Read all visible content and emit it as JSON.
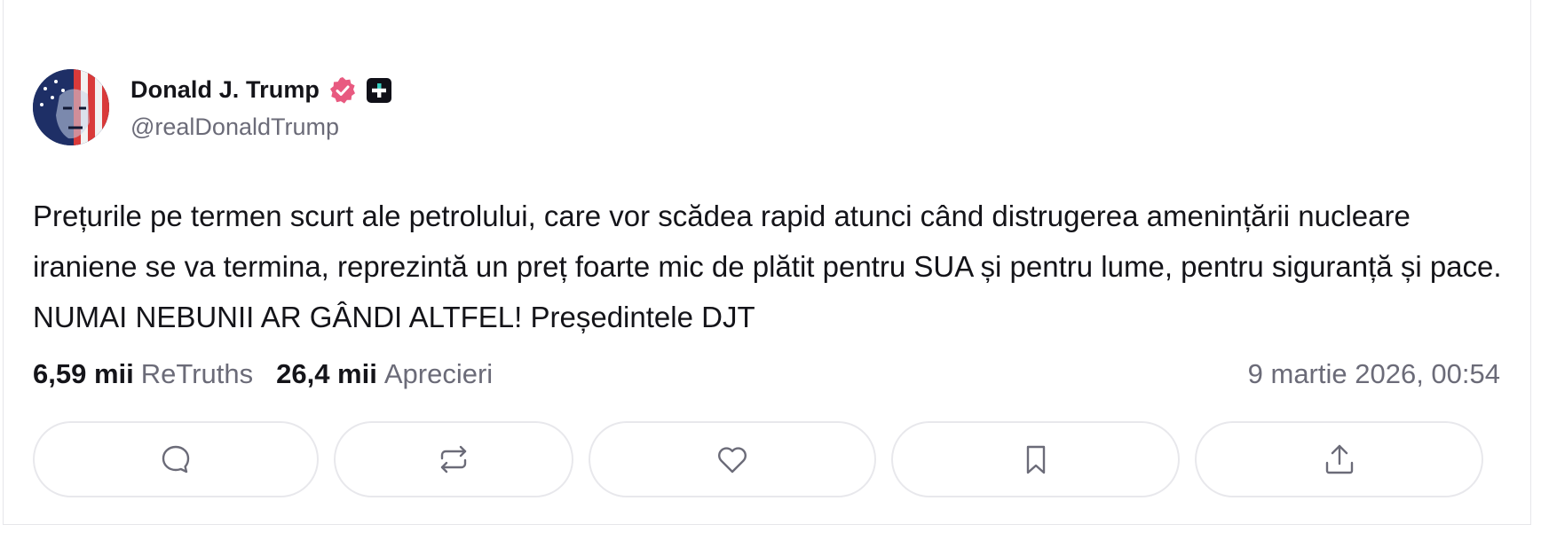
{
  "post": {
    "author": {
      "display_name": "Donald J. Trump",
      "handle": "@realDonaldTrump",
      "verified": true,
      "avatar": "avatar-portrait"
    },
    "text": "Prețurile pe termen scurt ale petrolului, care vor scădea rapid atunci când distrugerea amenințării nucleare iraniene se va termina, reprezintă un preț foarte mic de plătit pentru SUA și pentru lume, pentru siguranță și pace. NUMAI NEBUNII AR GÂNDI ALTFEL! Președintele DJT",
    "stats": {
      "retruths_count": "6,59 mii",
      "retruths_label": "ReTruths",
      "likes_count": "26,4 mii",
      "likes_label": "Aprecieri"
    },
    "timestamp": "9 martie 2026, 00:54"
  },
  "actions": [
    {
      "name": "reply",
      "icon": "comment-icon"
    },
    {
      "name": "retruth",
      "icon": "repost-icon"
    },
    {
      "name": "like",
      "icon": "heart-icon"
    },
    {
      "name": "bookmark",
      "icon": "bookmark-icon"
    },
    {
      "name": "share",
      "icon": "share-icon"
    }
  ],
  "colors": {
    "verified_badge": "#e85a80",
    "muted_text": "#6b6b78",
    "border": "#e8e8ec"
  }
}
